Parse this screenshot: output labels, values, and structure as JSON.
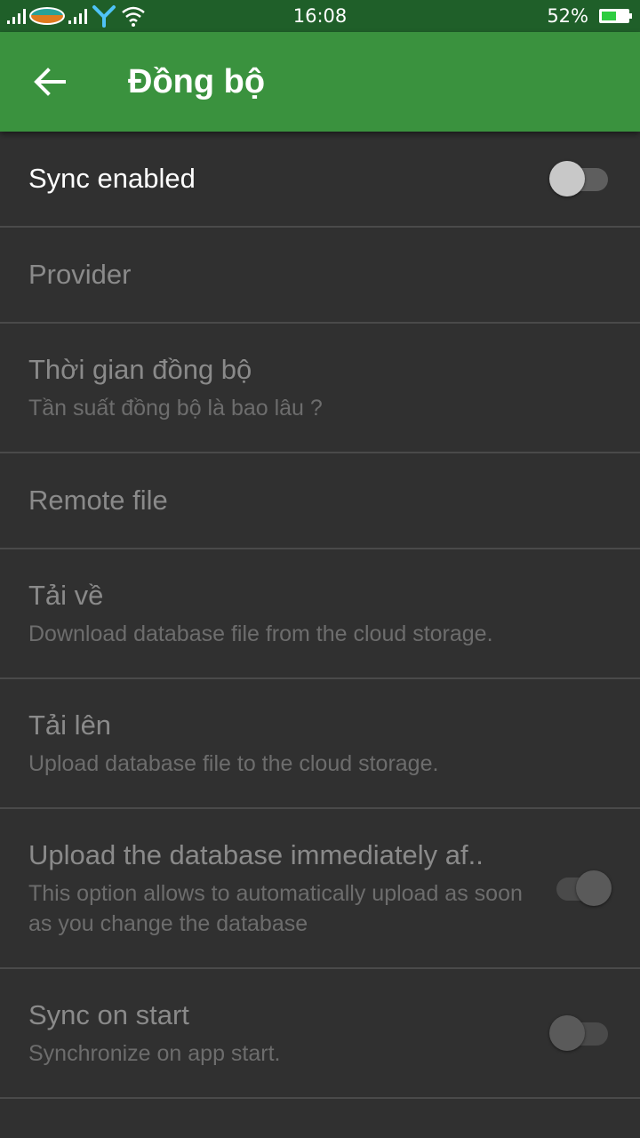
{
  "status_bar": {
    "time": "16:08",
    "battery": "52%"
  },
  "toolbar": {
    "title": "Đồng bộ",
    "back_icon": "arrow-left-icon"
  },
  "settings": [
    {
      "id": "sync-enabled",
      "title": "Sync enabled",
      "summary": "",
      "enabled": true,
      "switch": "off"
    },
    {
      "id": "provider",
      "title": "Provider",
      "summary": "",
      "enabled": false,
      "switch": null
    },
    {
      "id": "sync-interval",
      "title": "Thời gian đồng bộ",
      "summary": "Tần suất đồng bộ là bao lâu ?",
      "enabled": false,
      "switch": null
    },
    {
      "id": "remote-file",
      "title": "Remote file",
      "summary": "",
      "enabled": false,
      "switch": null
    },
    {
      "id": "download",
      "title": "Tải về",
      "summary": "Download database file from the cloud storage.",
      "enabled": false,
      "switch": null
    },
    {
      "id": "upload",
      "title": "Tải lên",
      "summary": "Upload database file to the cloud storage.",
      "enabled": false,
      "switch": null
    },
    {
      "id": "upload-immediately",
      "title": "Upload the database immediately af..",
      "summary": "This option allows to automatically upload as soon as you change the database",
      "enabled": false,
      "switch": "on"
    },
    {
      "id": "sync-on-start",
      "title": "Sync on start",
      "summary": "Synchronize on app start.",
      "enabled": false,
      "switch": "off"
    }
  ],
  "colors": {
    "status_bar": "#1f5f29",
    "app_bar": "#3a923e",
    "background": "#303030",
    "divider": "#4a4a4a"
  }
}
